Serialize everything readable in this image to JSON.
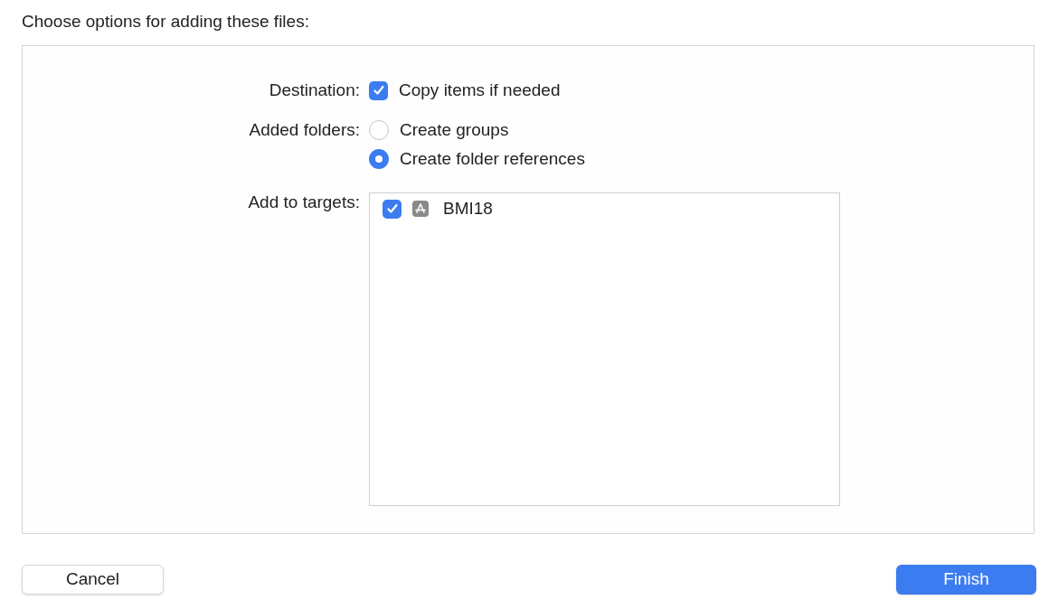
{
  "heading": "Choose options for adding these files:",
  "destination": {
    "label": "Destination:",
    "option": {
      "label": "Copy items if needed",
      "checked": true
    }
  },
  "added_folders": {
    "label": "Added folders:",
    "options": [
      {
        "label": "Create groups",
        "selected": false
      },
      {
        "label": "Create folder references",
        "selected": true
      }
    ]
  },
  "targets": {
    "label": "Add to targets:",
    "items": [
      {
        "label": "BMI18",
        "checked": true
      }
    ]
  },
  "buttons": [
    {
      "label": "Cancel",
      "kind": "secondary"
    },
    {
      "label": "Finish",
      "kind": "primary"
    }
  ]
}
